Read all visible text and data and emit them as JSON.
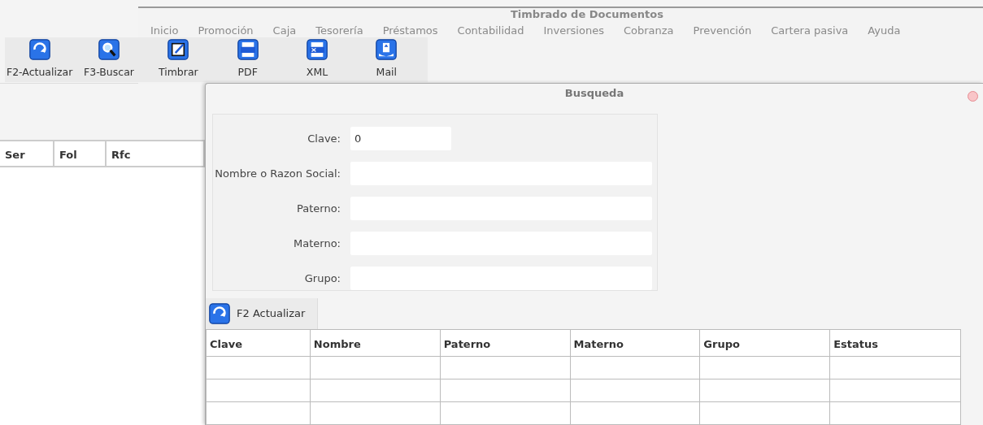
{
  "window": {
    "title": "Timbrado de Documentos"
  },
  "menu": [
    "Inicio",
    "Promoción",
    "Caja",
    "Tesorería",
    "Préstamos",
    "Contabilidad",
    "Inversiones",
    "Cobranza",
    "Prevención",
    "Cartera pasiva",
    "Ayuda"
  ],
  "toolbar": [
    {
      "kind": "refresh",
      "label": "F2-Actualizar"
    },
    {
      "kind": "search",
      "label": "F3-Buscar"
    },
    {
      "kind": "stamp",
      "label": "Timbrar"
    },
    {
      "kind": "pdf",
      "label": "PDF"
    },
    {
      "kind": "xml",
      "label": "XML"
    },
    {
      "kind": "mail",
      "label": "Mail"
    }
  ],
  "main_table": {
    "columns": [
      "Ser",
      "Fol",
      "Rfc"
    ]
  },
  "dialog": {
    "title": "Busqueda",
    "fields": [
      {
        "label": "Clave:",
        "value": "0",
        "kind": "short"
      },
      {
        "label": "Nombre o Razon Social:",
        "kind": "long"
      },
      {
        "label": "Paterno:",
        "kind": "long"
      },
      {
        "label": "Materno:",
        "kind": "long"
      },
      {
        "label": "Grupo:",
        "kind": "long"
      }
    ],
    "button": "F2 Actualizar",
    "table": {
      "columns": [
        "Clave",
        "Nombre",
        "Paterno",
        "Materno",
        "Grupo",
        "Estatus"
      ]
    }
  }
}
